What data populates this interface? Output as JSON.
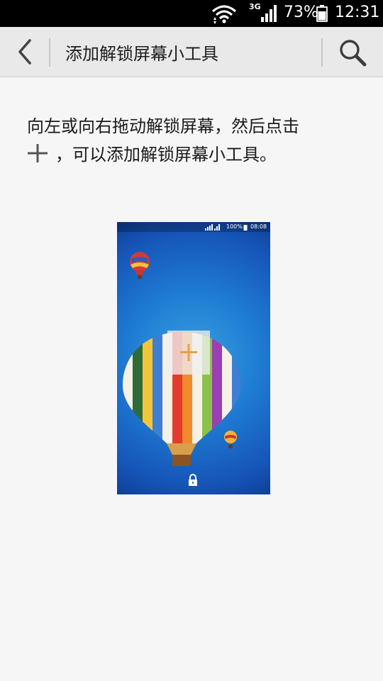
{
  "status_bar": {
    "network": "3G",
    "battery": "73%",
    "time": "12:31"
  },
  "action_bar": {
    "back_icon": "chevron-left-icon",
    "title": "添加解锁屏幕小工具",
    "search_icon": "search-icon"
  },
  "instruction": {
    "line1": "向左或向右拖动解锁屏幕，然后点击",
    "plus_icon": "plus-icon",
    "line2": "，可以添加解锁屏幕小工具。"
  },
  "preview": {
    "battery": "100%",
    "time": "08:08",
    "add_icon": "plus-icon",
    "lock_icon": "lock-icon"
  },
  "colors": {
    "action_bar_bg": "#e9e9e9",
    "page_bg": "#f6f6f6",
    "preview_blue": "#1f7ed4",
    "add_plus": "#e8a04a"
  }
}
